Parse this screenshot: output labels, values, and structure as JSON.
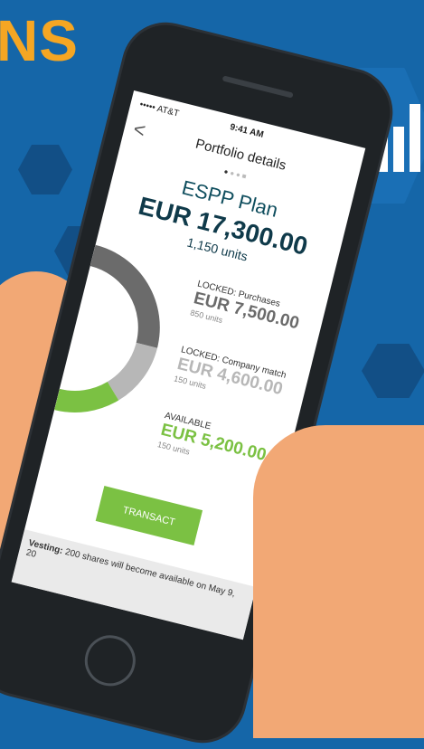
{
  "headline": "NS",
  "status": {
    "carrier": "••••• AT&T",
    "time": "9:41 AM"
  },
  "nav": {
    "title": "Portfolio details",
    "back_label": "<"
  },
  "pager": {
    "dots": "●●●■"
  },
  "plan": {
    "name": "ESPP Plan",
    "amount": "EUR 17,300.00",
    "units": "1,150 units"
  },
  "breakdown": [
    {
      "label": "LOCKED: Purchases",
      "value": "EUR 7,500.00",
      "units": "850 units",
      "color": "#6b6b6b"
    },
    {
      "label": "LOCKED: Company match",
      "value": "EUR 4,600.00",
      "units": "150 units",
      "color": "#b7b7b7"
    },
    {
      "label": "AVAILABLE",
      "value": "EUR 5,200.00",
      "units": "150 units",
      "color": "#7bc143"
    }
  ],
  "transact_label": "TRANSACT",
  "vesting": {
    "label": "Vesting:",
    "text": "200 shares will become available on May 9, 20"
  },
  "colors": {
    "accent": "#7bc143",
    "primary": "#0f3a4a",
    "background": "#1566a8",
    "headline": "#f5a623"
  },
  "icons": {
    "badge": "bar-chart-icon",
    "back": "chevron-left-icon",
    "home": "home-button-icon"
  }
}
